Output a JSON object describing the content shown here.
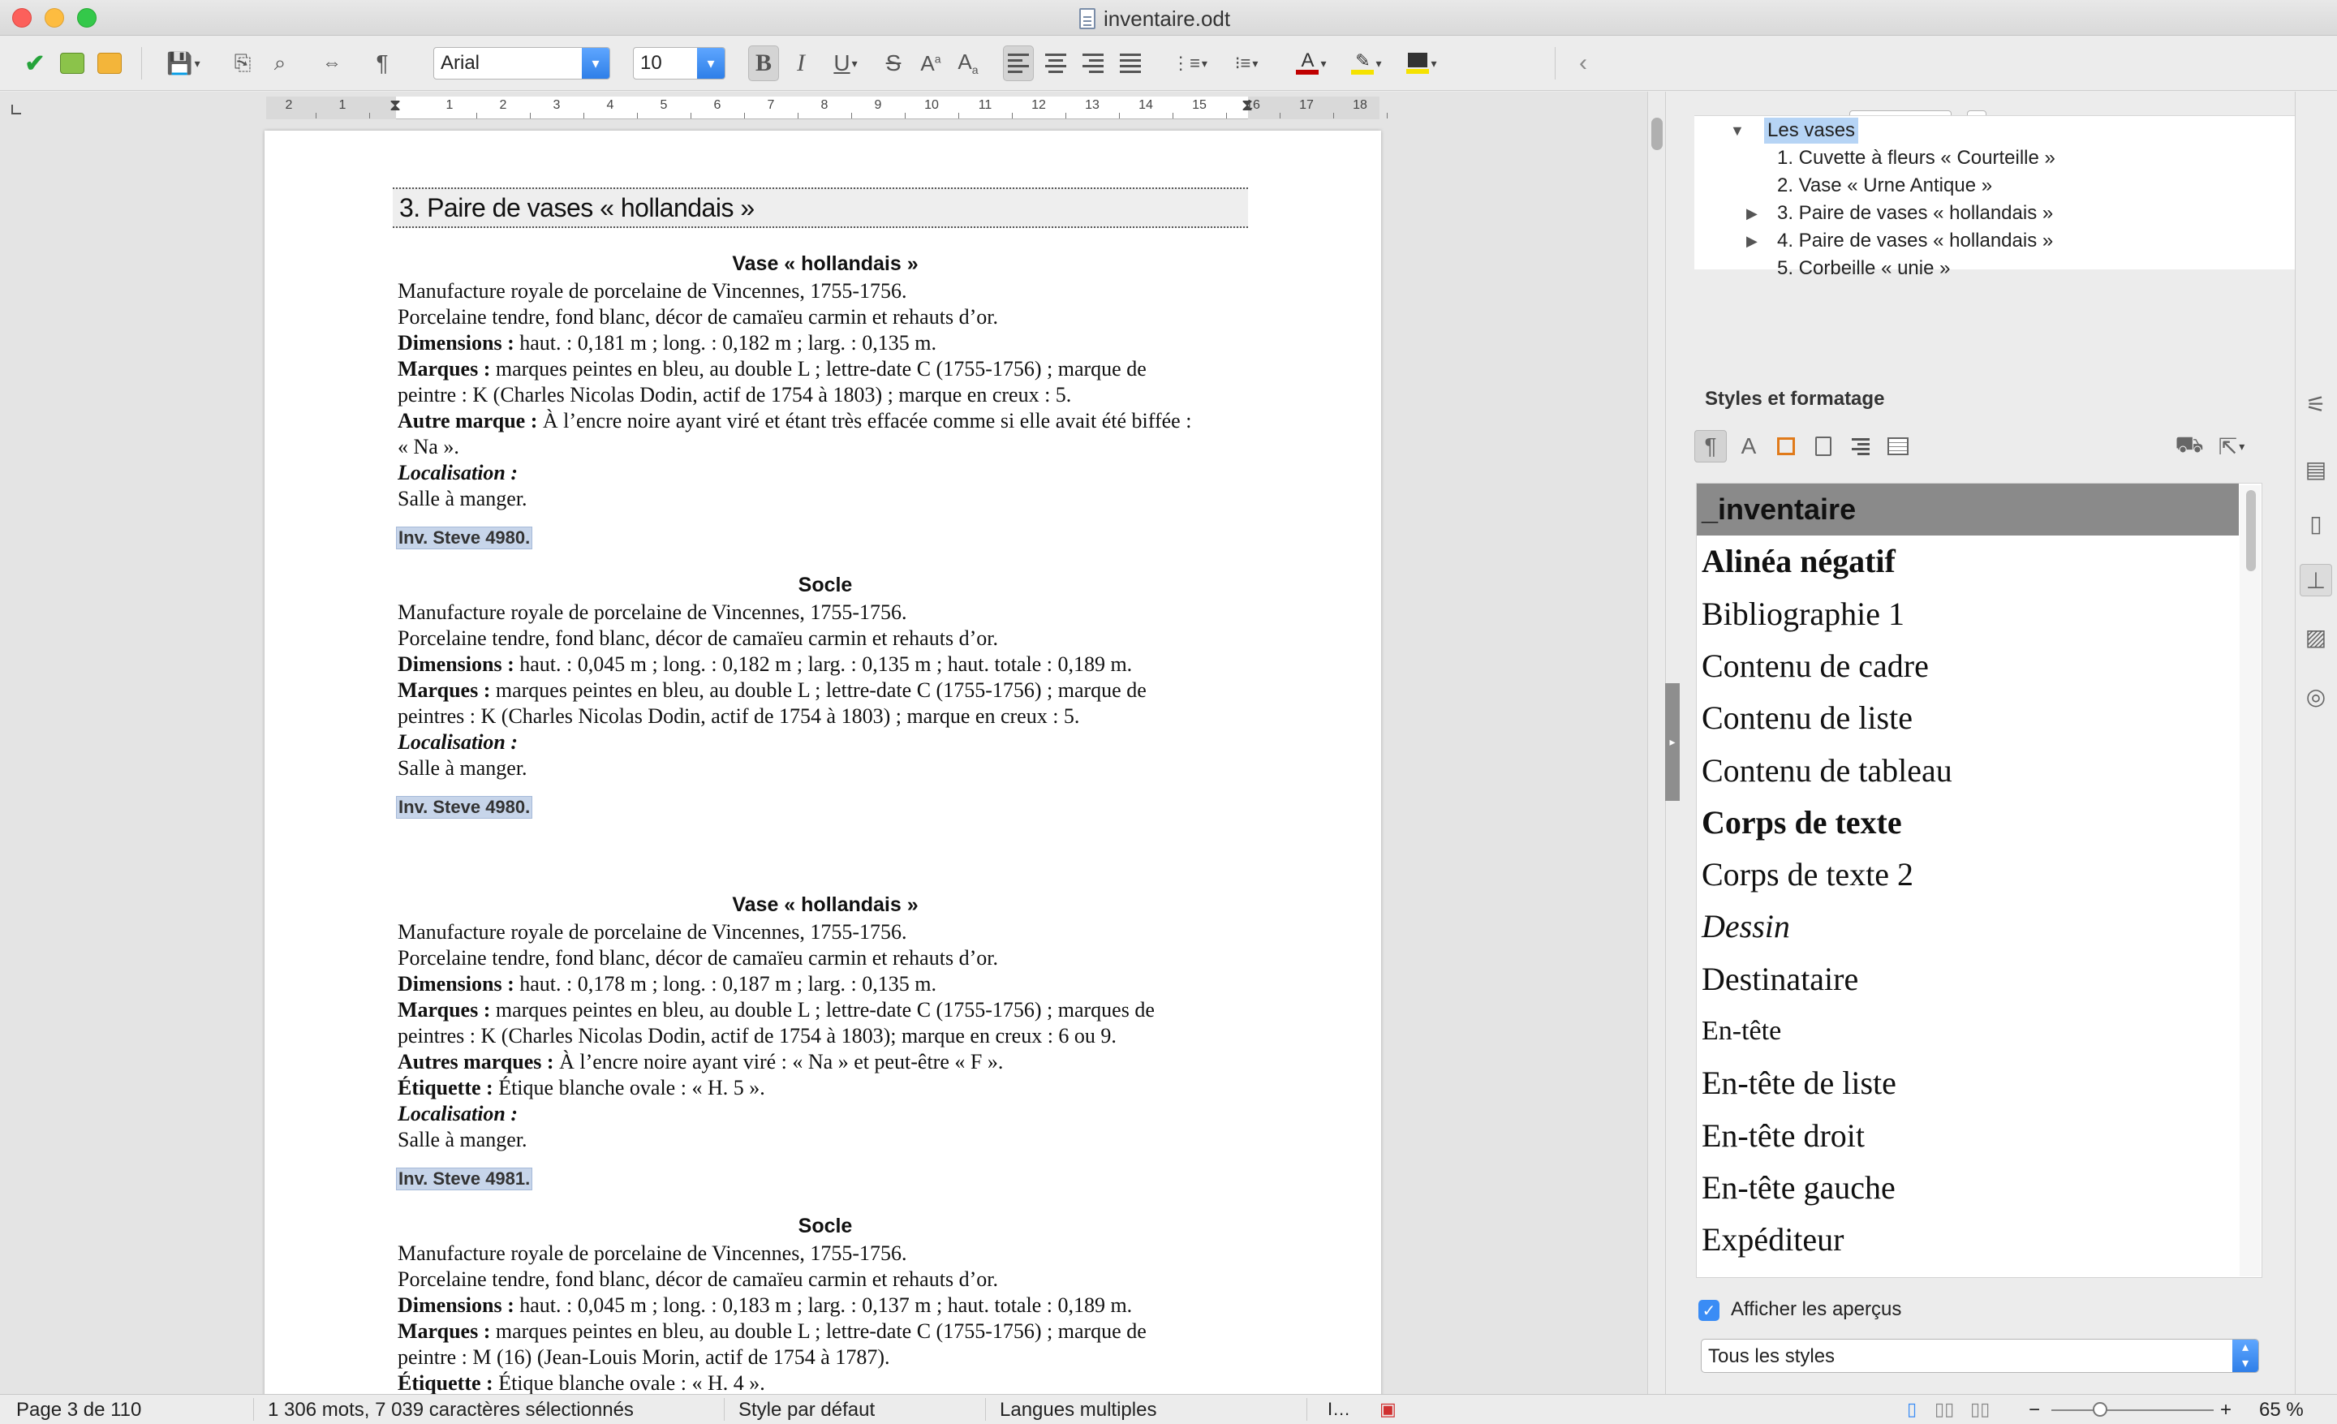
{
  "window": {
    "title": "inventaire.odt"
  },
  "toolbar": {
    "font_name": "Arial",
    "font_size": "10",
    "colors": {
      "font_color": "#c00000",
      "highlight": "#f5e200",
      "shading": "#f5e200"
    }
  },
  "ruler": {
    "labels": [
      "2",
      "1",
      "1",
      "2",
      "3",
      "4",
      "5",
      "6",
      "7",
      "8",
      "9",
      "10",
      "11",
      "12",
      "13",
      "14",
      "15",
      "16",
      "17",
      "18"
    ]
  },
  "document": {
    "heading": "3. Paire de vases « hollandais »",
    "sections": [
      {
        "title": "Vase « hollandais »",
        "lines": [
          {
            "label": "",
            "text": "Manufacture royale de porcelaine de Vincennes, 1755-1756."
          },
          {
            "label": "",
            "text": "Porcelaine tendre, fond blanc, décor de camaïeu carmin et rehauts d’or."
          },
          {
            "label": "Dimensions :",
            "text": " haut. : 0,181 m ; long. : 0,182 m ; larg. : 0,135 m."
          },
          {
            "label": "Marques :",
            "text": " marques peintes en bleu, au double L ; lettre-date C (1755-1756) ; marque de"
          },
          {
            "label": "",
            "text": "peintre : K  (Charles Nicolas Dodin, actif de 1754 à 1803) ; marque en creux : 5."
          },
          {
            "label": "Autre marque :",
            "text": " À l’encre noire ayant viré et étant très effacée comme si elle avait été biffée :"
          },
          {
            "label": "",
            "text": "« Na »."
          }
        ],
        "loc_label": "Localisation :",
        "loc_text": "Salle à manger.",
        "inv": "Inv. Steve 4980."
      },
      {
        "title": "Socle",
        "lines": [
          {
            "label": "",
            "text": "Manufacture royale de porcelaine de Vincennes, 1755-1756."
          },
          {
            "label": "",
            "text": "Porcelaine tendre, fond blanc, décor de camaïeu carmin et rehauts d’or."
          },
          {
            "label": "Dimensions :",
            "text": " haut. : 0,045 m ; long. : 0,182 m ; larg. : 0,135 m ; haut. totale : 0,189 m."
          },
          {
            "label": "Marques :",
            "text": " marques peintes en bleu, au double L ; lettre-date C (1755-1756) ; marque de"
          },
          {
            "label": "",
            "text": "peintres : K (Charles Nicolas Dodin, actif de 1754 à 1803) ; marque en creux : 5."
          }
        ],
        "loc_label": "Localisation :",
        "loc_text": "Salle à manger.",
        "inv": "Inv. Steve 4980."
      },
      {
        "title": "Vase « hollandais »",
        "lines": [
          {
            "label": "",
            "text": "Manufacture royale de porcelaine de Vincennes, 1755-1756."
          },
          {
            "label": "",
            "text": "Porcelaine tendre, fond blanc, décor de camaïeu carmin et rehauts d’or."
          },
          {
            "label": "Dimensions :",
            "text": " haut. : 0,178 m ; long. : 0,187 m ; larg. : 0,135 m."
          },
          {
            "label": "Marques :",
            "text": " marques peintes en bleu, au double L ; lettre-date C (1755-1756) ; marques de"
          },
          {
            "label": "",
            "text": "peintres : K (Charles Nicolas Dodin, actif de 1754 à 1803); marque en creux : 6 ou 9."
          },
          {
            "label": "Autres marques :",
            "text": " À l’encre noire ayant viré : « Na » et peut-être « F »."
          },
          {
            "label": "Étiquette :",
            "text": " Étique blanche ovale : « H. 5 »."
          }
        ],
        "loc_label": "Localisation :",
        "loc_text": "Salle à manger.",
        "inv": "Inv. Steve 4981."
      },
      {
        "title": "Socle",
        "lines": [
          {
            "label": "",
            "text": "Manufacture royale de porcelaine de Vincennes, 1755-1756."
          },
          {
            "label": "",
            "text": "Porcelaine tendre, fond blanc, décor de camaïeu carmin et rehauts d’or."
          },
          {
            "label": "Dimensions :",
            "text": " haut. : 0,045 m ; long. : 0,183 m ; larg. : 0,137 m ; haut. totale : 0,189 m."
          },
          {
            "label": "Marques :",
            "text": " marques peintes en bleu, au double L ; lettre-date C (1755-1756) ; marque de"
          },
          {
            "label": "",
            "text": "peintre : M (16) (Jean-Louis Morin, actif de 1754 à 1787)."
          },
          {
            "label": "Étiquette :",
            "text": " Étique blanche ovale : « H. 4 »."
          }
        ],
        "loc_label": "Localisation :",
        "loc_text": "Salle à manger.",
        "inv": ""
      }
    ]
  },
  "navigator": {
    "page_value": "1",
    "tree": [
      {
        "text": "Les vases",
        "level": 0,
        "expanded": true,
        "selected": true
      },
      {
        "text": "1. Cuvette à fleurs « Courteille »",
        "level": 1,
        "expandable": false
      },
      {
        "text": "2. Vase « Urne Antique »",
        "level": 1,
        "expandable": false
      },
      {
        "text": "3. Paire de vases « hollandais »",
        "level": 1,
        "expandable": true
      },
      {
        "text": "4. Paire de vases « hollandais »",
        "level": 1,
        "expandable": true
      },
      {
        "text": "5. Corbeille « unie »",
        "level": 1,
        "expandable": false
      }
    ]
  },
  "styles": {
    "header": "Styles et formatage",
    "items": [
      {
        "text": "_inventaire",
        "selected": true
      },
      {
        "text": "Alinéa négatif",
        "weight": "bold"
      },
      {
        "text": "Bibliographie 1"
      },
      {
        "text": "Contenu de cadre"
      },
      {
        "text": "Contenu de liste"
      },
      {
        "text": "Contenu de tableau"
      },
      {
        "text": "Corps de texte",
        "weight": "bold"
      },
      {
        "text": "Corps de texte 2"
      },
      {
        "text": "Dessin",
        "style": "italic"
      },
      {
        "text": "Destinataire"
      },
      {
        "text": "En-tête",
        "small": true
      },
      {
        "text": "En-tête de liste"
      },
      {
        "text": "En-tête droit"
      },
      {
        "text": "En-tête gauche"
      },
      {
        "text": "Expéditeur"
      }
    ],
    "show_previews_label": "Afficher les aperçus",
    "show_previews_checked": true,
    "filter_value": "Tous les styles"
  },
  "statusbar": {
    "page": "Page 3 de 110",
    "words": "1 306 mots, 7 039 caractères sélectionnés",
    "page_style": "Style par défaut",
    "language": "Langues multiples",
    "zoom": "65 %",
    "zoom_fraction": 0.3
  }
}
